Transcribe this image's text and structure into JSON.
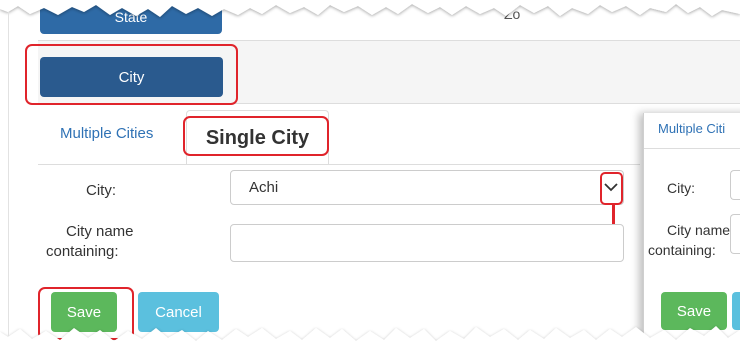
{
  "top": {
    "state_button_label": "State",
    "partial_text": "Zo"
  },
  "city_section": {
    "city_button_label": "City"
  },
  "tabs": {
    "multiple_label": "Multiple Cities",
    "single_label": "Single City"
  },
  "form": {
    "city_label": "City:",
    "city_value": "Achi",
    "name_label_line1": "City name",
    "name_label_line2": "containing:",
    "name_value": ""
  },
  "actions": {
    "save_label": "Save",
    "cancel_label": "Cancel"
  },
  "inset": {
    "tab_label": "Multiple Citi",
    "city_label": "City:",
    "name_label_line1": "City name",
    "name_label_line2": "containing:",
    "save_label": "Save"
  },
  "colors": {
    "primary": "#2a5a8e",
    "success": "#5cb85c",
    "info": "#5bc0de",
    "highlight": "#e0242b",
    "link": "#2f72b5"
  },
  "icons": {
    "dropdown": "chevron-down-icon",
    "annotation_arrow": "arrow-down-icon"
  }
}
